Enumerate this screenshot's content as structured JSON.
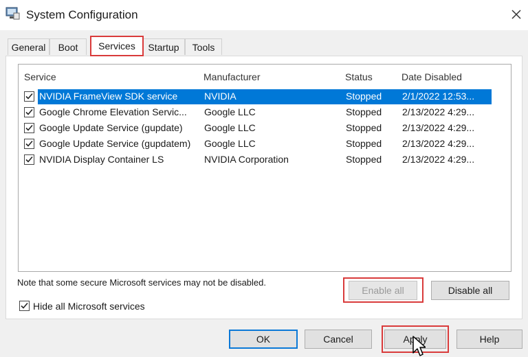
{
  "window": {
    "title": "System Configuration",
    "icon": "msconfig-icon",
    "close_icon": "close-icon"
  },
  "tabs": [
    {
      "label": "General",
      "active": false
    },
    {
      "label": "Boot",
      "active": false
    },
    {
      "label": "Services",
      "active": true
    },
    {
      "label": "Startup",
      "active": false
    },
    {
      "label": "Tools",
      "active": false
    }
  ],
  "services": {
    "columns": [
      "Service",
      "Manufacturer",
      "Status",
      "Date Disabled"
    ],
    "rows": [
      {
        "checked": true,
        "selected": true,
        "service": "NVIDIA FrameView SDK service",
        "manufacturer": "NVIDIA",
        "status": "Stopped",
        "date_disabled": "2/1/2022 12:53..."
      },
      {
        "checked": true,
        "selected": false,
        "service": "Google Chrome Elevation Servic...",
        "manufacturer": "Google LLC",
        "status": "Stopped",
        "date_disabled": "2/13/2022 4:29..."
      },
      {
        "checked": true,
        "selected": false,
        "service": "Google Update Service (gupdate)",
        "manufacturer": "Google LLC",
        "status": "Stopped",
        "date_disabled": "2/13/2022 4:29..."
      },
      {
        "checked": true,
        "selected": false,
        "service": "Google Update Service (gupdatem)",
        "manufacturer": "Google LLC",
        "status": "Stopped",
        "date_disabled": "2/13/2022 4:29..."
      },
      {
        "checked": true,
        "selected": false,
        "service": "NVIDIA Display Container LS",
        "manufacturer": "NVIDIA Corporation",
        "status": "Stopped",
        "date_disabled": "2/13/2022 4:29..."
      }
    ],
    "note": "Note that some secure Microsoft services may not be disabled.",
    "enable_all": {
      "label": "Enable all",
      "enabled": false
    },
    "disable_all": {
      "label": "Disable all",
      "enabled": true
    },
    "hide_ms": {
      "label": "Hide all Microsoft services",
      "checked": true
    }
  },
  "footer": {
    "ok": "OK",
    "cancel": "Cancel",
    "apply": "Apply",
    "help": "Help"
  },
  "colors": {
    "highlight": "#d93a3a",
    "selection": "#0078d7"
  }
}
